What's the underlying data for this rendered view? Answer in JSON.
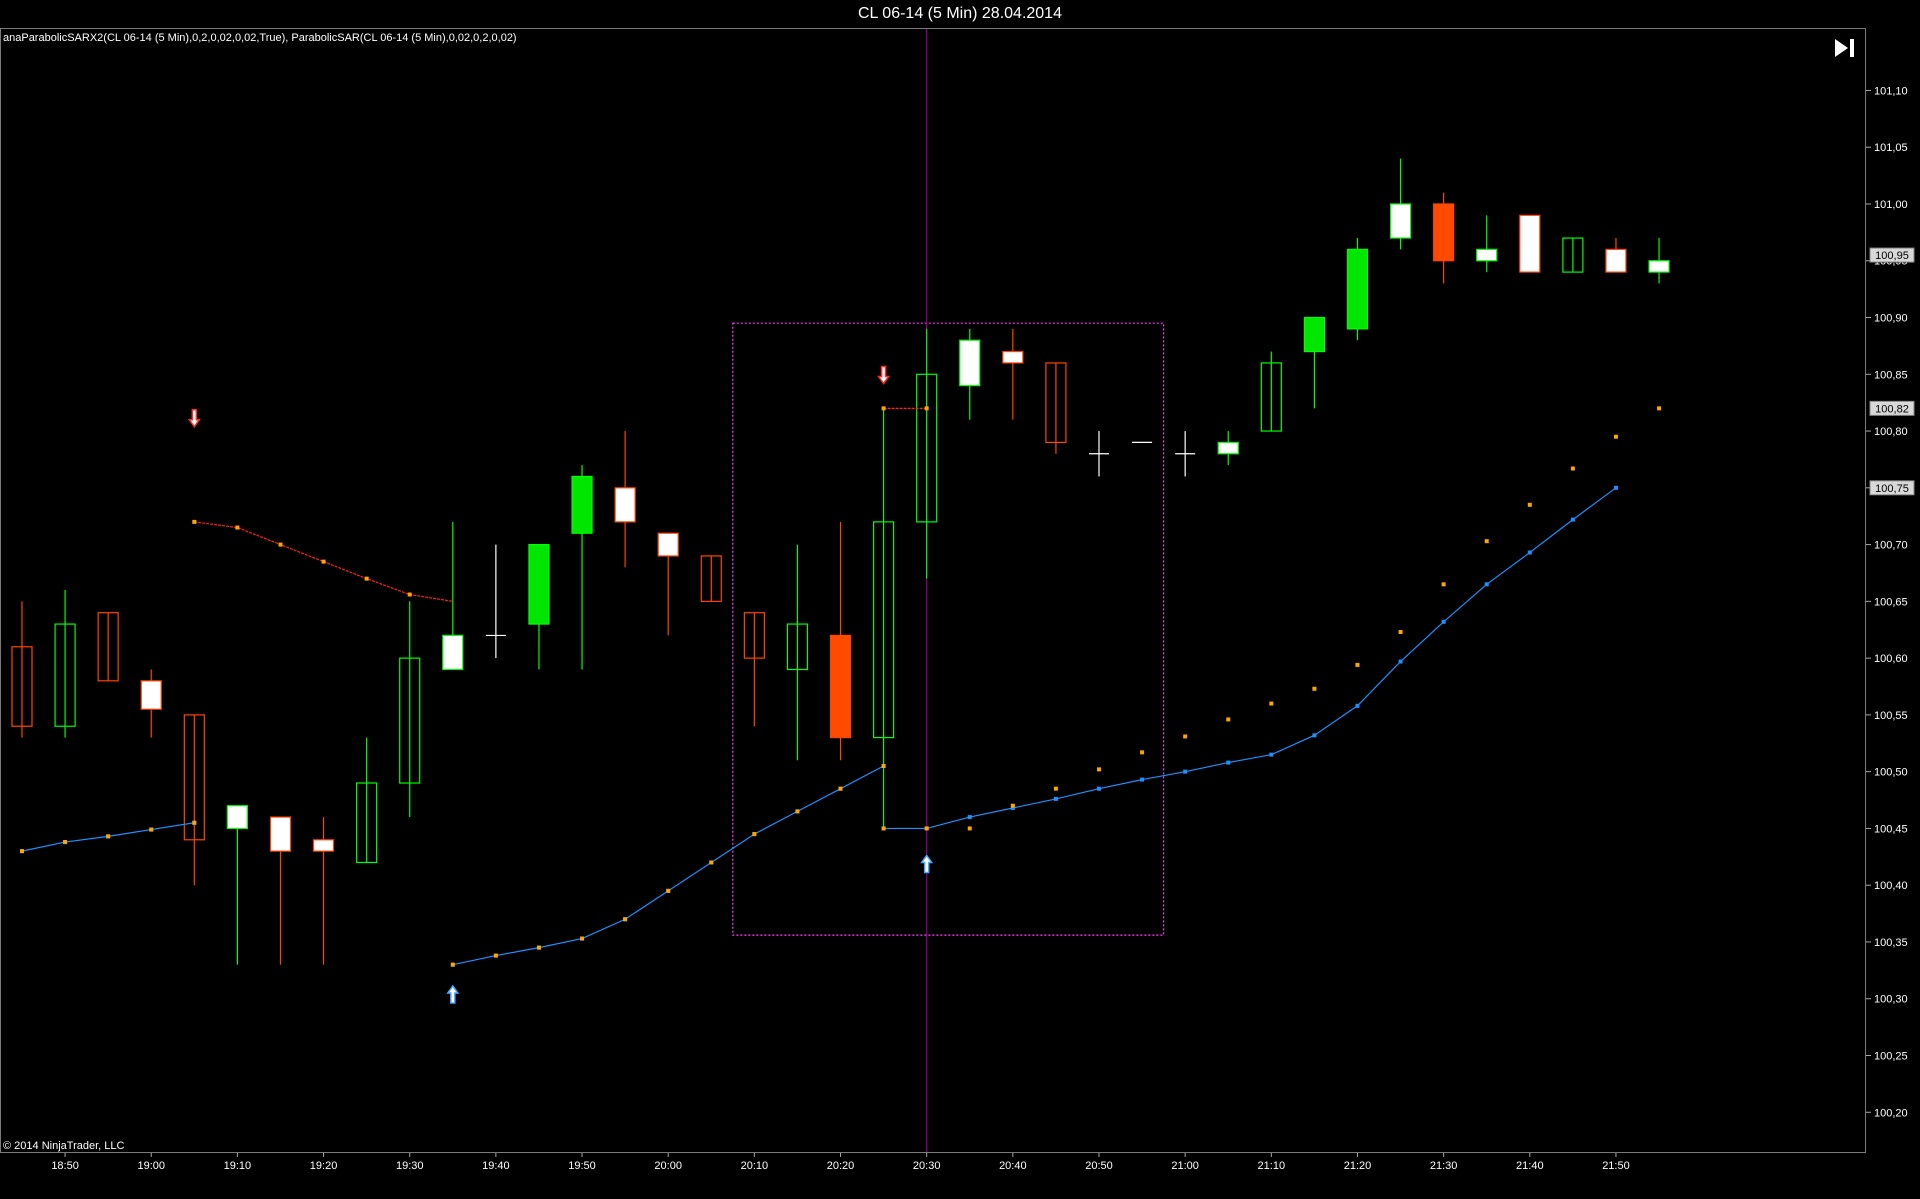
{
  "window": {
    "title": "CL 06-14 (5 Min)  28.04.2014"
  },
  "indicator_label": "anaParabolicSARX2(CL 06-14 (5 Min),0,2,0,02,0,02,True), ParabolicSAR(CL 06-14 (5 Min),0,02,0,2,0,02)",
  "copyright": "© 2014 NinjaTrader, LLC",
  "controls": {
    "go_last_icon": "skip-to-end-icon"
  },
  "colors": {
    "up_candle": "#00ff00",
    "down_candle": "#ff4500",
    "up_fill": "#00e600",
    "down_fill": "#ff4a00",
    "flat_candle": "#ffffff",
    "sar_orange": "#ffa500",
    "sar_blue": "#1e90ff",
    "sar_red_line": "#ff2020",
    "box": "#ff40ff",
    "cursor": "#a000a0"
  },
  "chart_data": {
    "type": "candlestick",
    "title": "CL 06-14 (5 Min)  28.04.2014",
    "ylim": [
      100.165,
      101.155
    ],
    "y_ticks": [
      "101,10",
      "101,05",
      "101,00",
      "100,95",
      "100,90",
      "100,85",
      "100,80",
      "100,75",
      "100,70",
      "100,65",
      "100,60",
      "100,55",
      "100,50",
      "100,45",
      "100,40",
      "100,35",
      "100,30",
      "100,25",
      "100,20"
    ],
    "x_ticks": [
      "18:50",
      "19:00",
      "19:10",
      "19:20",
      "19:30",
      "19:40",
      "19:50",
      "20:00",
      "20:10",
      "20:20",
      "20:30",
      "20:40",
      "20:50",
      "21:00",
      "21:10",
      "21:20",
      "21:30",
      "21:40",
      "21:50"
    ],
    "bars": [
      {
        "t": "18:50",
        "o": 100.61,
        "h": 100.65,
        "l": 100.53,
        "c": 100.54,
        "fill": "hollow"
      },
      {
        "t": "18:55",
        "o": 100.54,
        "h": 100.66,
        "l": 100.53,
        "c": 100.63,
        "fill": "hollow"
      },
      {
        "t": "19:00",
        "o": 100.64,
        "h": 100.64,
        "l": 100.58,
        "c": 100.58,
        "fill": "hollow"
      },
      {
        "t": "19:05",
        "o": 100.58,
        "h": 100.59,
        "l": 100.53,
        "c": 100.555,
        "fill": "white"
      },
      {
        "t": "19:10",
        "o": 100.55,
        "h": 100.55,
        "l": 100.4,
        "c": 100.44,
        "fill": "hollow"
      },
      {
        "t": "19:15",
        "o": 100.45,
        "h": 100.47,
        "l": 100.33,
        "c": 100.47,
        "fill": "white"
      },
      {
        "t": "19:20",
        "o": 100.46,
        "h": 100.46,
        "l": 100.33,
        "c": 100.43,
        "fill": "white"
      },
      {
        "t": "19:25",
        "o": 100.44,
        "h": 100.46,
        "l": 100.33,
        "c": 100.43,
        "fill": "white"
      },
      {
        "t": "19:30",
        "o": 100.42,
        "h": 100.53,
        "l": 100.42,
        "c": 100.49,
        "fill": "hollow"
      },
      {
        "t": "19:35",
        "o": 100.49,
        "h": 100.65,
        "l": 100.46,
        "c": 100.6,
        "fill": "hollow"
      },
      {
        "t": "19:40",
        "o": 100.59,
        "h": 100.72,
        "l": 100.59,
        "c": 100.62,
        "fill": "white"
      },
      {
        "t": "19:45",
        "o": 100.62,
        "h": 100.7,
        "l": 100.6,
        "c": 100.62,
        "fill": "doji"
      },
      {
        "t": "19:50",
        "o": 100.63,
        "h": 100.7,
        "l": 100.59,
        "c": 100.7,
        "fill": "solid"
      },
      {
        "t": "19:55",
        "o": 100.71,
        "h": 100.77,
        "l": 100.59,
        "c": 100.76,
        "fill": "solid"
      },
      {
        "t": "20:00",
        "o": 100.75,
        "h": 100.8,
        "l": 100.68,
        "c": 100.72,
        "fill": "white"
      },
      {
        "t": "20:05",
        "o": 100.71,
        "h": 100.71,
        "l": 100.62,
        "c": 100.69,
        "fill": "white"
      },
      {
        "t": "20:10",
        "o": 100.69,
        "h": 100.69,
        "l": 100.65,
        "c": 100.65,
        "fill": "hollow"
      },
      {
        "t": "20:15",
        "o": 100.64,
        "h": 100.64,
        "l": 100.54,
        "c": 100.6,
        "fill": "hollow"
      },
      {
        "t": "20:20",
        "o": 100.59,
        "h": 100.7,
        "l": 100.51,
        "c": 100.63,
        "fill": "hollow"
      },
      {
        "t": "20:25",
        "o": 100.62,
        "h": 100.72,
        "l": 100.51,
        "c": 100.53,
        "fill": "solid"
      },
      {
        "t": "20:30",
        "o": 100.53,
        "h": 100.82,
        "l": 100.45,
        "c": 100.72,
        "fill": "hollow"
      },
      {
        "t": "20:35",
        "o": 100.72,
        "h": 100.89,
        "l": 100.67,
        "c": 100.85,
        "fill": "hollow"
      },
      {
        "t": "20:40",
        "o": 100.84,
        "h": 100.89,
        "l": 100.81,
        "c": 100.88,
        "fill": "white"
      },
      {
        "t": "20:45",
        "o": 100.87,
        "h": 100.89,
        "l": 100.81,
        "c": 100.86,
        "fill": "white"
      },
      {
        "t": "20:50",
        "o": 100.86,
        "h": 100.86,
        "l": 100.78,
        "c": 100.79,
        "fill": "hollow"
      },
      {
        "t": "20:55",
        "o": 100.78,
        "h": 100.8,
        "l": 100.76,
        "c": 100.78,
        "fill": "doji"
      },
      {
        "t": "21:00",
        "o": 100.79,
        "h": 100.79,
        "l": 100.79,
        "c": 100.79,
        "fill": "doji"
      },
      {
        "t": "21:05",
        "o": 100.78,
        "h": 100.8,
        "l": 100.76,
        "c": 100.78,
        "fill": "doji"
      },
      {
        "t": "21:10",
        "o": 100.78,
        "h": 100.8,
        "l": 100.77,
        "c": 100.79,
        "fill": "white"
      },
      {
        "t": "21:15",
        "o": 100.8,
        "h": 100.87,
        "l": 100.8,
        "c": 100.86,
        "fill": "hollow"
      },
      {
        "t": "21:20",
        "o": 100.87,
        "h": 100.9,
        "l": 100.82,
        "c": 100.9,
        "fill": "solid"
      },
      {
        "t": "21:25",
        "o": 100.89,
        "h": 100.97,
        "l": 100.88,
        "c": 100.96,
        "fill": "solid"
      },
      {
        "t": "21:30",
        "o": 100.97,
        "h": 101.04,
        "l": 100.96,
        "c": 101.0,
        "fill": "white"
      },
      {
        "t": "21:35",
        "o": 101.0,
        "h": 101.01,
        "l": 100.93,
        "c": 100.95,
        "fill": "solid"
      },
      {
        "t": "21:40",
        "o": 100.96,
        "h": 100.99,
        "l": 100.94,
        "c": 100.95,
        "fill": "white"
      },
      {
        "t": "21:45",
        "o": 100.99,
        "h": 100.99,
        "l": 100.94,
        "c": 100.94,
        "fill": "white"
      },
      {
        "t": "21:50",
        "o": 100.94,
        "h": 100.97,
        "l": 100.94,
        "c": 100.97,
        "fill": "hollow"
      },
      {
        "t": "21:55",
        "o": 100.96,
        "h": 100.97,
        "l": 100.94,
        "c": 100.94,
        "fill": "white"
      },
      {
        "t": "22:00",
        "o": 100.94,
        "h": 100.97,
        "l": 100.93,
        "c": 100.95,
        "fill": "white"
      }
    ],
    "bar_colors": [
      "down",
      "up",
      "down",
      "down",
      "down",
      "up",
      "down",
      "down",
      "up",
      "up",
      "up",
      "flat",
      "up",
      "up",
      "down",
      "down",
      "down",
      "down",
      "up",
      "down",
      "up",
      "up",
      "up",
      "down",
      "down",
      "flat",
      "flat",
      "flat",
      "up",
      "up",
      "up",
      "up",
      "up",
      "down",
      "up",
      "down",
      "up",
      "down",
      "up"
    ],
    "sar_orange": [
      [
        0,
        100.43
      ],
      [
        1,
        100.438
      ],
      [
        2,
        100.443
      ],
      [
        3,
        100.449
      ],
      [
        4,
        100.455
      ],
      [
        4,
        100.72
      ],
      [
        5,
        100.715
      ],
      [
        6,
        100.7
      ],
      [
        7,
        100.685
      ],
      [
        8,
        100.67
      ],
      [
        9,
        100.656
      ],
      [
        10,
        100.33
      ],
      [
        11,
        100.338
      ],
      [
        12,
        100.345
      ],
      [
        13,
        100.353
      ],
      [
        14,
        100.37
      ],
      [
        15,
        100.395
      ],
      [
        16,
        100.42
      ],
      [
        17,
        100.445
      ],
      [
        18,
        100.465
      ],
      [
        19,
        100.485
      ],
      [
        20,
        100.505
      ],
      [
        20,
        100.82
      ],
      [
        21,
        100.82
      ],
      [
        20,
        100.45
      ],
      [
        21,
        100.45
      ],
      [
        22,
        100.45
      ],
      [
        23,
        100.47
      ],
      [
        24,
        100.485
      ],
      [
        25,
        100.502
      ],
      [
        26,
        100.517
      ],
      [
        27,
        100.531
      ],
      [
        28,
        100.546
      ],
      [
        29,
        100.56
      ],
      [
        30,
        100.573
      ],
      [
        31,
        100.594
      ],
      [
        32,
        100.623
      ],
      [
        33,
        100.665
      ],
      [
        34,
        100.703
      ],
      [
        35,
        100.735
      ],
      [
        36,
        100.767
      ],
      [
        37,
        100.795
      ],
      [
        38,
        100.82
      ]
    ],
    "sar_blue_segments": [
      [
        [
          0,
          100.43
        ],
        [
          1,
          100.438
        ],
        [
          2,
          100.443
        ],
        [
          3,
          100.449
        ],
        [
          4,
          100.455
        ]
      ],
      [
        [
          10,
          100.33
        ],
        [
          11,
          100.338
        ],
        [
          12,
          100.345
        ],
        [
          13,
          100.353
        ],
        [
          14,
          100.37
        ],
        [
          15,
          100.395
        ],
        [
          16,
          100.42
        ],
        [
          17,
          100.445
        ],
        [
          18,
          100.465
        ],
        [
          19,
          100.485
        ],
        [
          20,
          100.505
        ]
      ],
      [
        [
          20,
          100.45
        ],
        [
          21,
          100.45
        ],
        [
          22,
          100.46
        ],
        [
          23,
          100.468
        ],
        [
          24,
          100.476
        ],
        [
          25,
          100.485
        ],
        [
          26,
          100.493
        ],
        [
          27,
          100.5
        ],
        [
          28,
          100.508
        ],
        [
          29,
          100.515
        ],
        [
          30,
          100.532
        ],
        [
          31,
          100.558
        ],
        [
          32,
          100.597
        ],
        [
          33,
          100.632
        ],
        [
          34,
          100.665
        ],
        [
          35,
          100.693
        ],
        [
          36,
          100.722
        ],
        [
          37,
          100.75
        ]
      ]
    ],
    "sar_red_segments": [
      [
        [
          4,
          100.72
        ],
        [
          5,
          100.715
        ],
        [
          6,
          100.7
        ],
        [
          7,
          100.685
        ],
        [
          8,
          100.67
        ],
        [
          9,
          100.656
        ],
        [
          10,
          100.65
        ]
      ],
      [
        [
          20,
          100.82
        ],
        [
          21,
          100.82
        ]
      ]
    ],
    "signals": [
      {
        "bar": 4,
        "dir": "down",
        "y": 100.81
      },
      {
        "bar": 10,
        "dir": "up",
        "y": 100.305
      },
      {
        "bar": 20,
        "dir": "down",
        "y": 100.848
      },
      {
        "bar": 21,
        "dir": "up",
        "y": 100.42
      }
    ],
    "price_markers": [
      "100,95",
      "100,82",
      "100,75"
    ],
    "price_marker_values": [
      100.955,
      100.82,
      100.75
    ],
    "highlight_box": {
      "x0": 16.5,
      "x1": 26.5,
      "y0": 100.356,
      "y1": 100.895
    },
    "cursor_bar": 21
  }
}
